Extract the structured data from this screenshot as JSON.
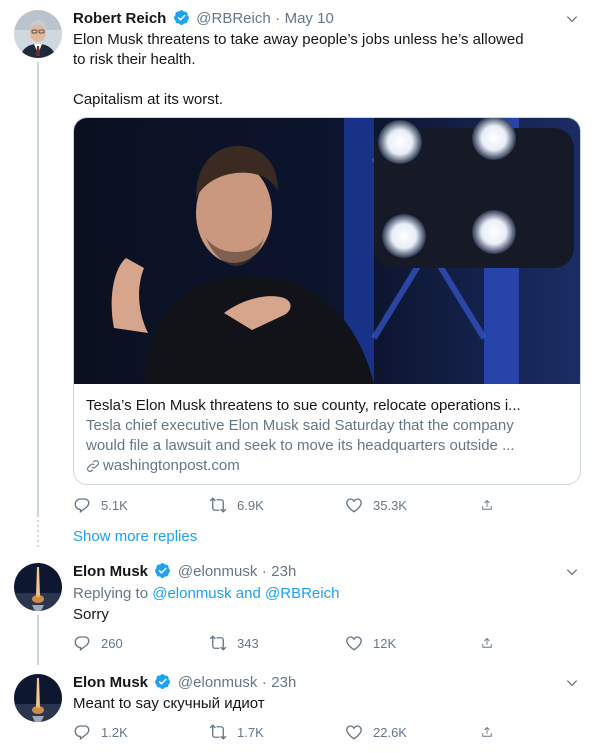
{
  "colors": {
    "accent": "#1da1f2",
    "muted": "#657786",
    "text": "#14171a",
    "line": "#ccd6dd"
  },
  "tweet1": {
    "name": "Robert Reich",
    "handle": "@RBReich",
    "sep": "·",
    "date": "May 10",
    "line1": "Elon Musk threatens to take away people’s jobs unless he’s allowed",
    "line2": "to risk their health.",
    "line3": "Capitalism at its worst.",
    "card": {
      "title": "Tesla’s Elon Musk threatens to sue county, relocate operations i...",
      "desc1": "Tesla chief executive Elon Musk said Saturday that the company",
      "desc2": "would file a lawsuit and seek to move its headquarters outside ...",
      "domain": "washingtonpost.com"
    },
    "stats": {
      "replies": "5.1K",
      "retweets": "6.9K",
      "likes": "35.3K"
    }
  },
  "show_more": "Show more replies",
  "tweet2": {
    "name": "Elon Musk",
    "handle": "@elonmusk",
    "sep": "·",
    "date": "23h",
    "replying_prefix": "Replying to",
    "replying_to": "@elonmusk and @RBReich",
    "text": "Sorry",
    "stats": {
      "replies": "260",
      "retweets": "343",
      "likes": "12K"
    }
  },
  "tweet3": {
    "name": "Elon Musk",
    "handle": "@elonmusk",
    "sep": "·",
    "date": "23h",
    "text": "Meant to say скучный идиот",
    "stats": {
      "replies": "1.2K",
      "retweets": "1.7K",
      "likes": "22.6K"
    }
  }
}
